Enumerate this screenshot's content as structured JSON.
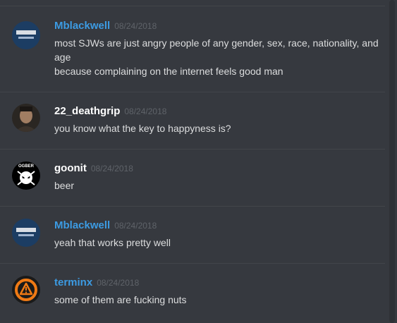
{
  "colors": {
    "background": "#36393f",
    "divider": "#42454a",
    "message_text": "#dcddde",
    "timestamp": "#5f6369",
    "username_blue": "#3c9be3",
    "username_white": "#ffffff"
  },
  "messages": [
    {
      "username": "Mblackwell",
      "timestamp": "08/24/2018",
      "avatar_icon": "mblackwell-logo-avatar",
      "lines": [
        "most SJWs are just angry people of any gender, sex, race, nationality, and",
        "age",
        "because complaining on the internet feels good man"
      ]
    },
    {
      "username": "22_deathgrip",
      "timestamp": "08/24/2018",
      "avatar_icon": "portrait-avatar",
      "lines": [
        "you know what the key to happyness is?"
      ]
    },
    {
      "username": "goonit",
      "timestamp": "08/24/2018",
      "avatar_icon": "dog-skull-avatar",
      "avatar_text": "OGBER",
      "lines": [
        "beer"
      ]
    },
    {
      "username": "Mblackwell",
      "timestamp": "08/24/2018",
      "avatar_icon": "mblackwell-logo-avatar",
      "lines": [
        "yeah that works pretty well"
      ]
    },
    {
      "username": "terminx",
      "timestamp": "08/24/2018",
      "avatar_icon": "warning-triangle-avatar",
      "lines": [
        "some of them are fucking nuts"
      ]
    }
  ]
}
